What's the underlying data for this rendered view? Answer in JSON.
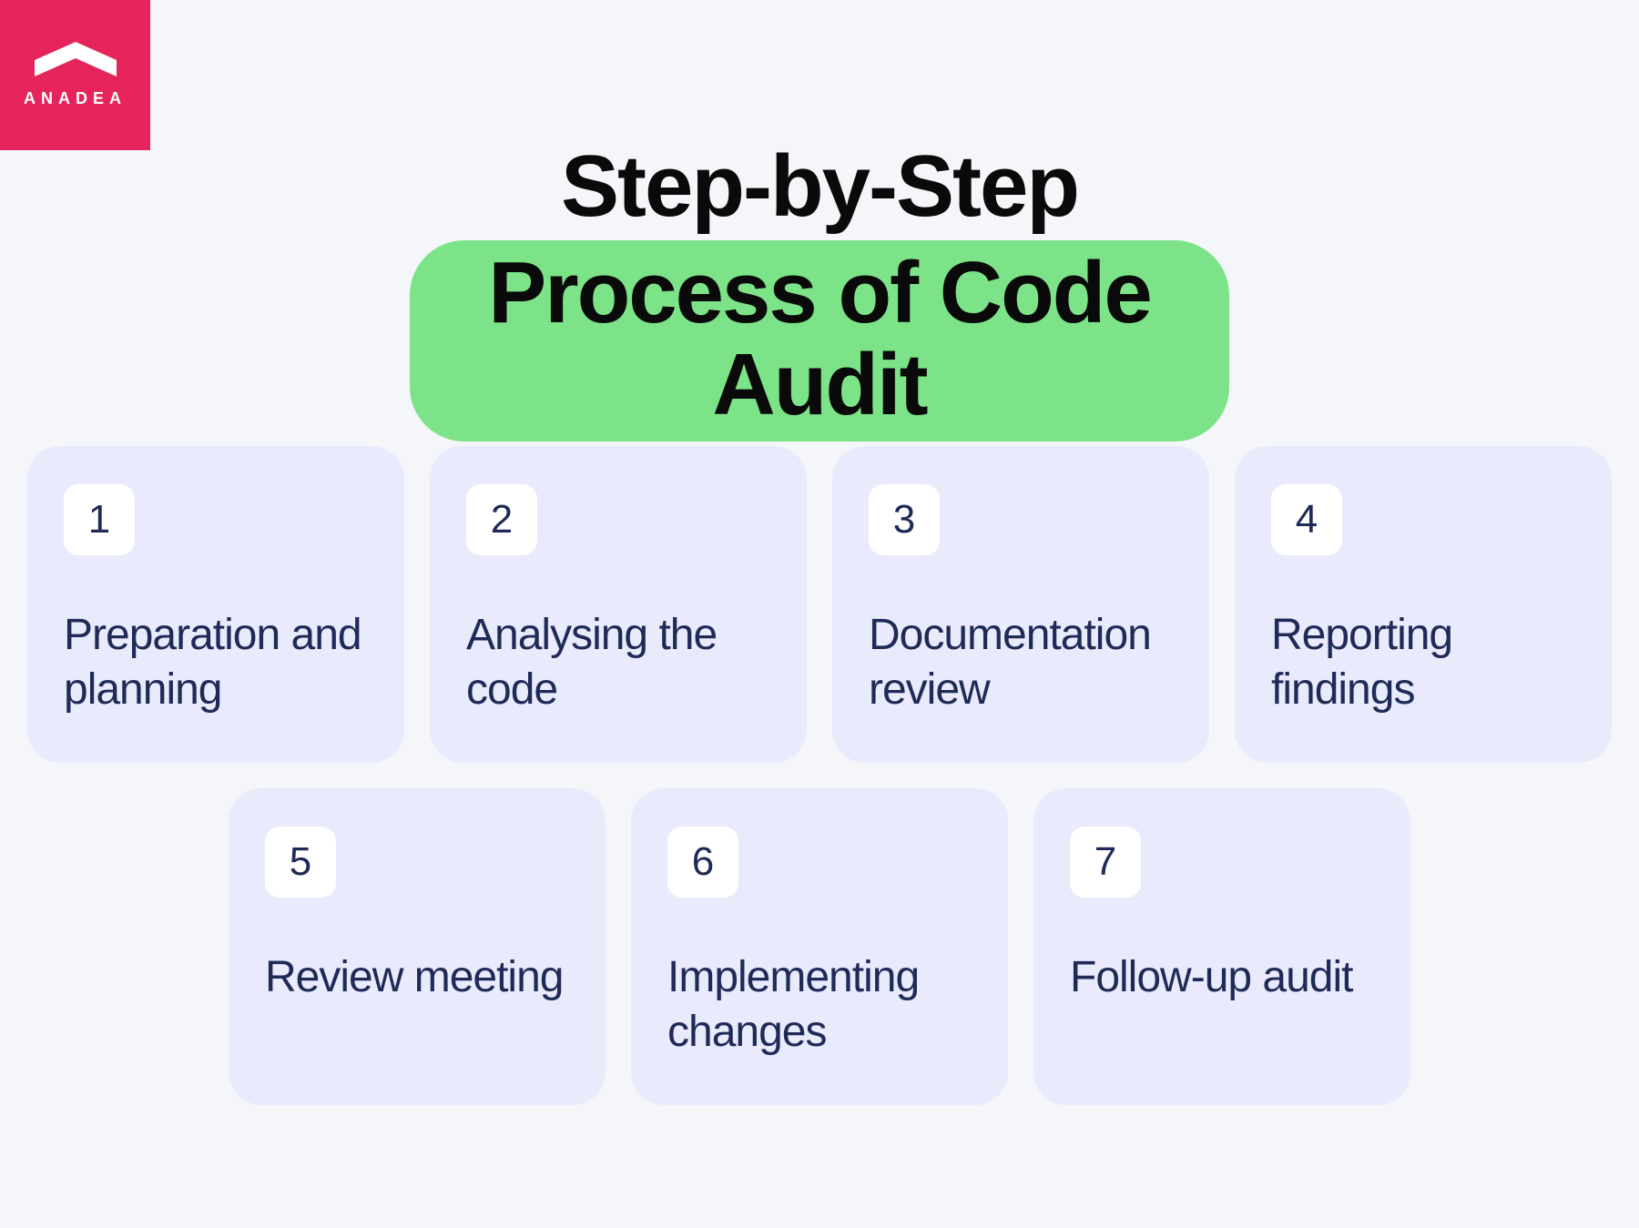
{
  "brand": {
    "name": "ANADEA"
  },
  "heading": {
    "line1": "Step-by-Step",
    "line2": "Process of Code Audit"
  },
  "steps": [
    {
      "num": "1",
      "label": "Preparation and planning"
    },
    {
      "num": "2",
      "label": "Analysing the code"
    },
    {
      "num": "3",
      "label": "Documenta­tion review"
    },
    {
      "num": "4",
      "label": "Reporting findings"
    },
    {
      "num": "5",
      "label": "Review meeting"
    },
    {
      "num": "6",
      "label": "Implementing changes"
    },
    {
      "num": "7",
      "label": "Follow-up audit"
    }
  ],
  "colors": {
    "brand": "#e4245b",
    "highlight": "#7de388",
    "card_bg": "#e9eafc",
    "text_dark": "#1f2a57",
    "page_bg": "#f5f6fa"
  }
}
